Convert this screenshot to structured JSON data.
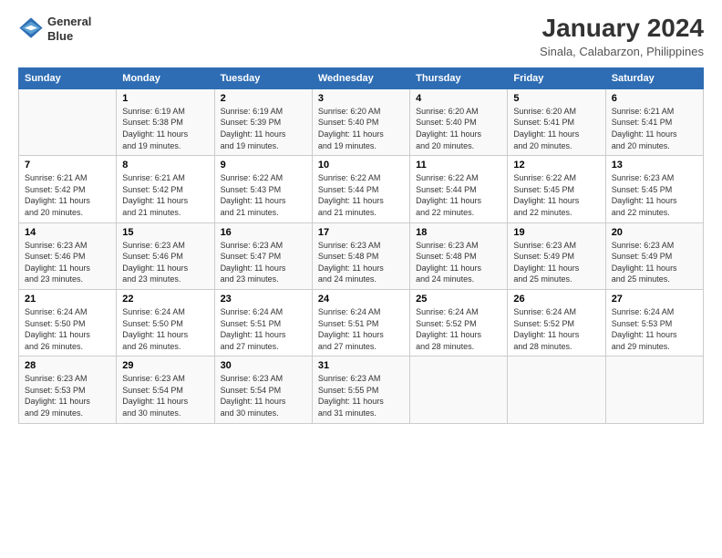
{
  "header": {
    "logo_line1": "General",
    "logo_line2": "Blue",
    "title": "January 2024",
    "subtitle": "Sinala, Calabarzon, Philippines"
  },
  "days_of_week": [
    "Sunday",
    "Monday",
    "Tuesday",
    "Wednesday",
    "Thursday",
    "Friday",
    "Saturday"
  ],
  "weeks": [
    [
      {
        "num": "",
        "sunrise": "",
        "sunset": "",
        "daylight": ""
      },
      {
        "num": "1",
        "sunrise": "6:19 AM",
        "sunset": "5:38 PM",
        "daylight": "11 hours and 19 minutes."
      },
      {
        "num": "2",
        "sunrise": "6:19 AM",
        "sunset": "5:39 PM",
        "daylight": "11 hours and 19 minutes."
      },
      {
        "num": "3",
        "sunrise": "6:20 AM",
        "sunset": "5:40 PM",
        "daylight": "11 hours and 19 minutes."
      },
      {
        "num": "4",
        "sunrise": "6:20 AM",
        "sunset": "5:40 PM",
        "daylight": "11 hours and 20 minutes."
      },
      {
        "num": "5",
        "sunrise": "6:20 AM",
        "sunset": "5:41 PM",
        "daylight": "11 hours and 20 minutes."
      },
      {
        "num": "6",
        "sunrise": "6:21 AM",
        "sunset": "5:41 PM",
        "daylight": "11 hours and 20 minutes."
      }
    ],
    [
      {
        "num": "7",
        "sunrise": "6:21 AM",
        "sunset": "5:42 PM",
        "daylight": "11 hours and 20 minutes."
      },
      {
        "num": "8",
        "sunrise": "6:21 AM",
        "sunset": "5:42 PM",
        "daylight": "11 hours and 21 minutes."
      },
      {
        "num": "9",
        "sunrise": "6:22 AM",
        "sunset": "5:43 PM",
        "daylight": "11 hours and 21 minutes."
      },
      {
        "num": "10",
        "sunrise": "6:22 AM",
        "sunset": "5:44 PM",
        "daylight": "11 hours and 21 minutes."
      },
      {
        "num": "11",
        "sunrise": "6:22 AM",
        "sunset": "5:44 PM",
        "daylight": "11 hours and 22 minutes."
      },
      {
        "num": "12",
        "sunrise": "6:22 AM",
        "sunset": "5:45 PM",
        "daylight": "11 hours and 22 minutes."
      },
      {
        "num": "13",
        "sunrise": "6:23 AM",
        "sunset": "5:45 PM",
        "daylight": "11 hours and 22 minutes."
      }
    ],
    [
      {
        "num": "14",
        "sunrise": "6:23 AM",
        "sunset": "5:46 PM",
        "daylight": "11 hours and 23 minutes."
      },
      {
        "num": "15",
        "sunrise": "6:23 AM",
        "sunset": "5:46 PM",
        "daylight": "11 hours and 23 minutes."
      },
      {
        "num": "16",
        "sunrise": "6:23 AM",
        "sunset": "5:47 PM",
        "daylight": "11 hours and 23 minutes."
      },
      {
        "num": "17",
        "sunrise": "6:23 AM",
        "sunset": "5:48 PM",
        "daylight": "11 hours and 24 minutes."
      },
      {
        "num": "18",
        "sunrise": "6:23 AM",
        "sunset": "5:48 PM",
        "daylight": "11 hours and 24 minutes."
      },
      {
        "num": "19",
        "sunrise": "6:23 AM",
        "sunset": "5:49 PM",
        "daylight": "11 hours and 25 minutes."
      },
      {
        "num": "20",
        "sunrise": "6:23 AM",
        "sunset": "5:49 PM",
        "daylight": "11 hours and 25 minutes."
      }
    ],
    [
      {
        "num": "21",
        "sunrise": "6:24 AM",
        "sunset": "5:50 PM",
        "daylight": "11 hours and 26 minutes."
      },
      {
        "num": "22",
        "sunrise": "6:24 AM",
        "sunset": "5:50 PM",
        "daylight": "11 hours and 26 minutes."
      },
      {
        "num": "23",
        "sunrise": "6:24 AM",
        "sunset": "5:51 PM",
        "daylight": "11 hours and 27 minutes."
      },
      {
        "num": "24",
        "sunrise": "6:24 AM",
        "sunset": "5:51 PM",
        "daylight": "11 hours and 27 minutes."
      },
      {
        "num": "25",
        "sunrise": "6:24 AM",
        "sunset": "5:52 PM",
        "daylight": "11 hours and 28 minutes."
      },
      {
        "num": "26",
        "sunrise": "6:24 AM",
        "sunset": "5:52 PM",
        "daylight": "11 hours and 28 minutes."
      },
      {
        "num": "27",
        "sunrise": "6:24 AM",
        "sunset": "5:53 PM",
        "daylight": "11 hours and 29 minutes."
      }
    ],
    [
      {
        "num": "28",
        "sunrise": "6:23 AM",
        "sunset": "5:53 PM",
        "daylight": "11 hours and 29 minutes."
      },
      {
        "num": "29",
        "sunrise": "6:23 AM",
        "sunset": "5:54 PM",
        "daylight": "11 hours and 30 minutes."
      },
      {
        "num": "30",
        "sunrise": "6:23 AM",
        "sunset": "5:54 PM",
        "daylight": "11 hours and 30 minutes."
      },
      {
        "num": "31",
        "sunrise": "6:23 AM",
        "sunset": "5:55 PM",
        "daylight": "11 hours and 31 minutes."
      },
      {
        "num": "",
        "sunrise": "",
        "sunset": "",
        "daylight": ""
      },
      {
        "num": "",
        "sunrise": "",
        "sunset": "",
        "daylight": ""
      },
      {
        "num": "",
        "sunrise": "",
        "sunset": "",
        "daylight": ""
      }
    ]
  ],
  "labels": {
    "sunrise_prefix": "Sunrise: ",
    "sunset_prefix": "Sunset: ",
    "daylight_prefix": "Daylight: "
  }
}
